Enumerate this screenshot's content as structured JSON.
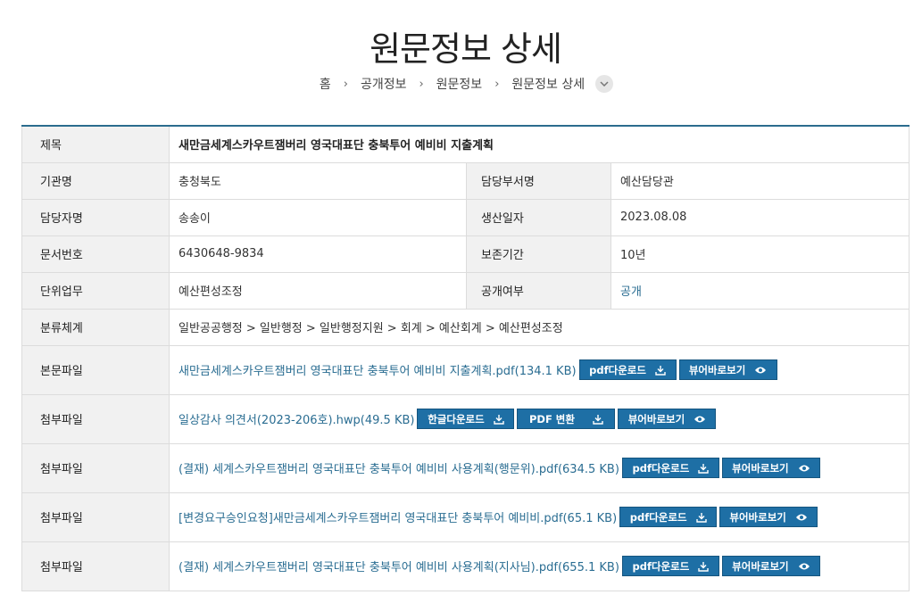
{
  "title": "원문정보 상세",
  "breadcrumb": [
    "홈",
    "공개정보",
    "원문정보",
    "원문정보 상세"
  ],
  "labels": {
    "subject": "제목",
    "org": "기관명",
    "dept": "담당부서명",
    "manager": "담당자명",
    "created": "생산일자",
    "docno": "문서번호",
    "retention": "보존기간",
    "task": "단위업무",
    "disclosure": "공개여부",
    "classification": "분류체계",
    "main_file": "본문파일",
    "attachment": "첨부파일"
  },
  "values": {
    "subject": "새만금세계스카우트잼버리 영국대표단 충북투어 예비비 지출계획",
    "org": "충청북도",
    "dept": "예산담당관",
    "manager": "송송이",
    "created": "2023.08.08",
    "docno": "6430648-9834",
    "retention": "10년",
    "task": "예산편성조정",
    "disclosure": "공개",
    "classification": "일반공공행정 > 일반행정 > 일반행정지원 > 회계 > 예산회계 > 예산편성조정"
  },
  "buttons": {
    "pdf_download": "pdf다운로드",
    "hwp_download": "한글다운로드",
    "pdf_convert": "PDF 변환",
    "viewer": "뷰어바로보기"
  },
  "files": {
    "main": "새만금세계스카우트잼버리 영국대표단 충북투어 예비비 지출계획.pdf(134.1 KB)",
    "att1": "일상감사 의견서(2023-206호).hwp(49.5 KB)",
    "att2": "(결재) 세계스카우트잼버리 영국대표단 충북투어 예비비 사용계획(행문위).pdf(634.5 KB)",
    "att3": "[변경요구승인요청]새만금세계스카우트잼버리 영국대표단 충북투어 예비비.pdf(65.1 KB)",
    "att4": "(결재) 세계스카우트잼버리 영국대표단 충북투어 예비비 사용계획(지사님).pdf(655.1 KB)"
  }
}
